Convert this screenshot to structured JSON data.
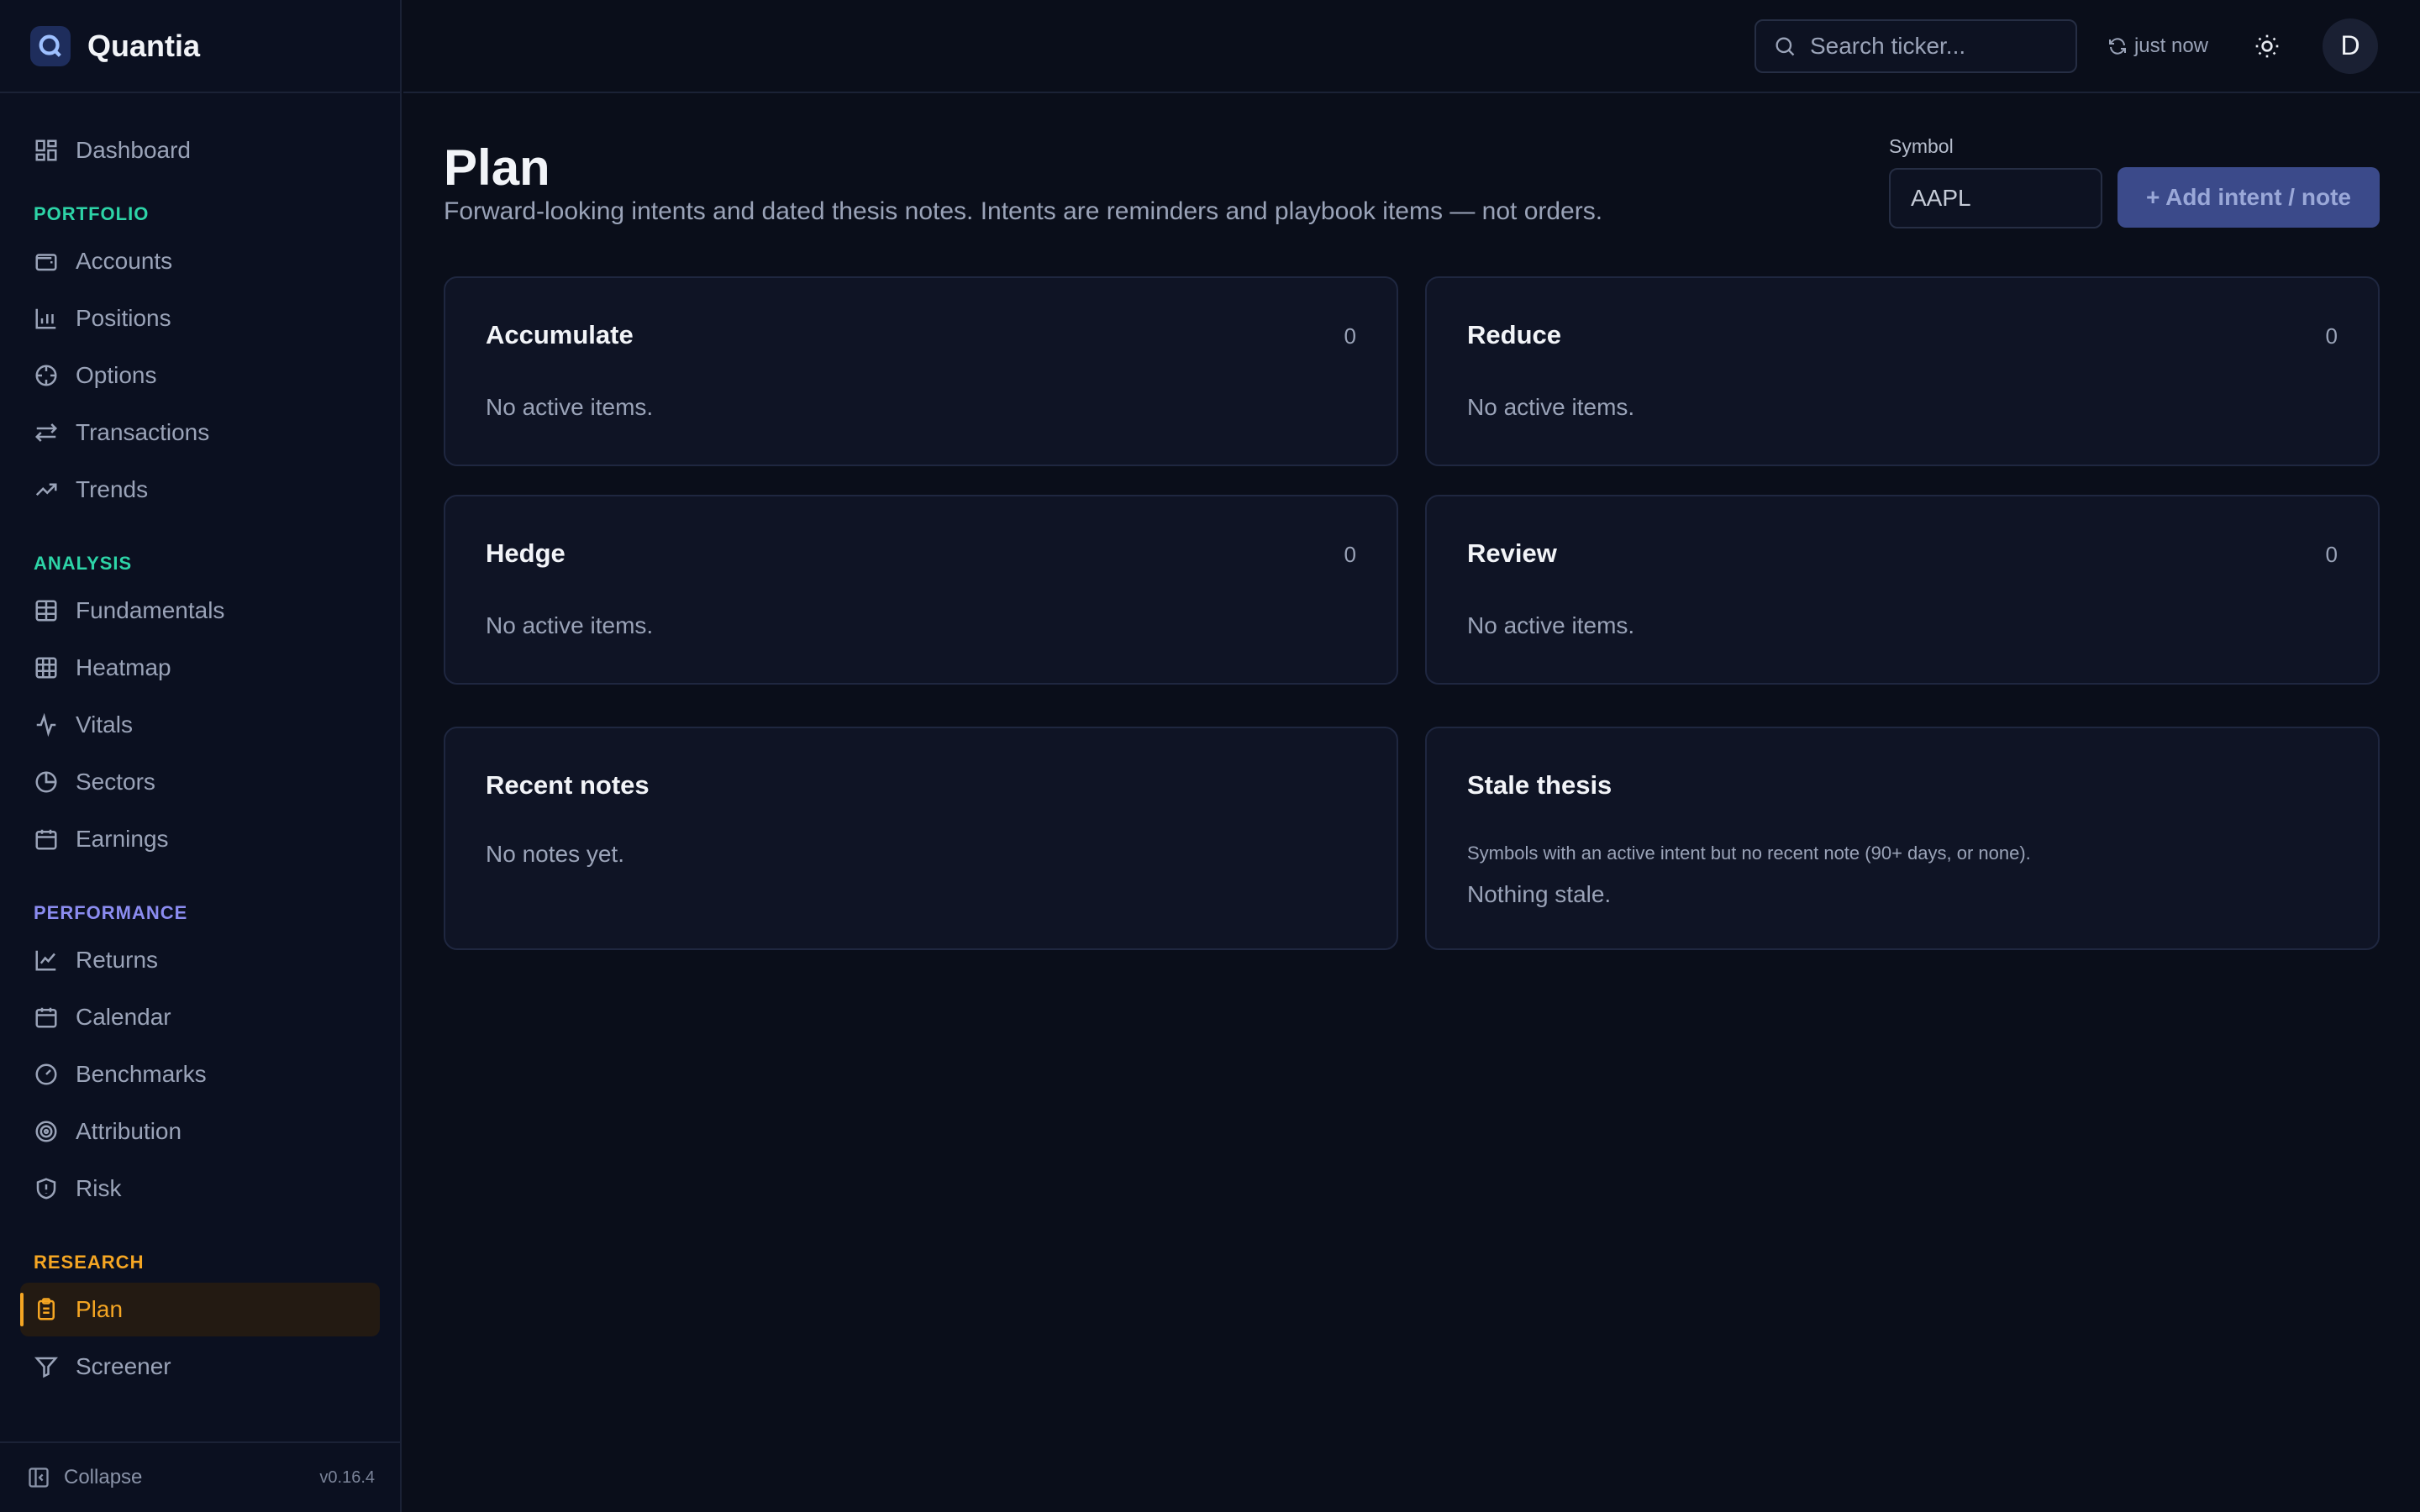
{
  "app": {
    "name": "Quantia",
    "version": "v0.16.4"
  },
  "sidebar": {
    "top_item": {
      "label": "Dashboard",
      "icon": "dashboard-icon"
    },
    "sections": [
      {
        "label": "PORTFOLIO",
        "color": "#2dd4a7",
        "items": [
          {
            "label": "Accounts",
            "icon": "wallet-icon"
          },
          {
            "label": "Positions",
            "icon": "bar-chart-icon"
          },
          {
            "label": "Options",
            "icon": "crosshair-icon"
          },
          {
            "label": "Transactions",
            "icon": "arrows-swap-icon"
          },
          {
            "label": "Trends",
            "icon": "trending-up-icon"
          }
        ]
      },
      {
        "label": "ANALYSIS",
        "color": "#2dd4a7",
        "items": [
          {
            "label": "Fundamentals",
            "icon": "table-icon"
          },
          {
            "label": "Heatmap",
            "icon": "grid-icon"
          },
          {
            "label": "Vitals",
            "icon": "pulse-icon"
          },
          {
            "label": "Sectors",
            "icon": "pie-chart-icon"
          },
          {
            "label": "Earnings",
            "icon": "calendar-icon"
          }
        ]
      },
      {
        "label": "PERFORMANCE",
        "color": "#8b8cf0",
        "items": [
          {
            "label": "Returns",
            "icon": "line-chart-icon"
          },
          {
            "label": "Calendar",
            "icon": "calendar-icon"
          },
          {
            "label": "Benchmarks",
            "icon": "gauge-icon"
          },
          {
            "label": "Attribution",
            "icon": "target-icon"
          },
          {
            "label": "Risk",
            "icon": "shield-icon"
          }
        ]
      },
      {
        "label": "RESEARCH",
        "color": "#f5a623",
        "items": [
          {
            "label": "Plan",
            "icon": "clipboard-icon",
            "active": true
          },
          {
            "label": "Screener",
            "icon": "filter-icon"
          }
        ]
      }
    ],
    "collapse_label": "Collapse"
  },
  "topbar": {
    "search_placeholder": "Search ticker...",
    "refresh_label": "just now",
    "avatar_initial": "D"
  },
  "page": {
    "title": "Plan",
    "subtitle": "Forward-looking intents and dated thesis notes. Intents are reminders and playbook items — not orders.",
    "symbol_label": "Symbol",
    "symbol_value": "AAPL",
    "add_button": "+ Add intent / note"
  },
  "cards": {
    "accumulate": {
      "title": "Accumulate",
      "count": "0",
      "body": "No active items."
    },
    "reduce": {
      "title": "Reduce",
      "count": "0",
      "body": "No active items."
    },
    "hedge": {
      "title": "Hedge",
      "count": "0",
      "body": "No active items."
    },
    "review": {
      "title": "Review",
      "count": "0",
      "body": "No active items."
    },
    "recent_notes": {
      "title": "Recent notes",
      "body": "No notes yet."
    },
    "stale_thesis": {
      "title": "Stale thesis",
      "description": "Symbols with an active intent but no recent note (90+ days, or none).",
      "body": "Nothing stale."
    }
  }
}
